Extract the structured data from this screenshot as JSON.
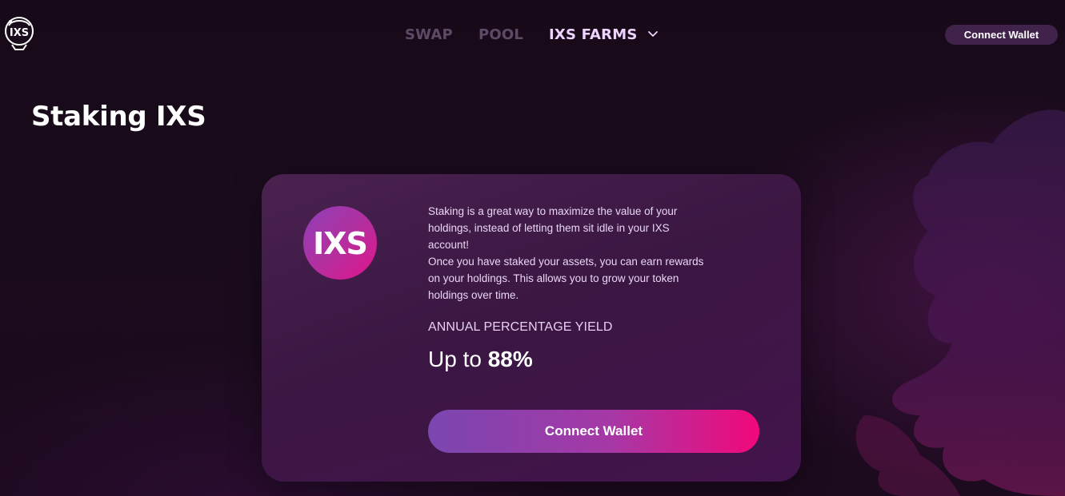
{
  "brand": {
    "logo_text": "IXS"
  },
  "nav": {
    "items": [
      {
        "label": "SWAP",
        "active": false
      },
      {
        "label": "POOL",
        "active": false
      },
      {
        "label": "IXS FARMS",
        "active": true,
        "has_dropdown": true
      }
    ]
  },
  "header": {
    "connect_wallet_label": "Connect Wallet"
  },
  "page": {
    "title": "Staking IXS"
  },
  "card": {
    "token_logo_text": "IXS",
    "description_lines": [
      "Staking is a great way to maximize the value of your",
      "holdings, instead of letting them sit idle in your IXS",
      "account!",
      "Once you have staked your assets, you can earn rewards",
      "on your holdings. This allows you to grow your token",
      "holdings over time."
    ],
    "apy_label": "ANNUAL PERCENTAGE YIELD",
    "apy_prefix": "Up to ",
    "apy_value": "88%",
    "cta_label": "Connect Wallet"
  },
  "colors": {
    "accent_start": "#7a46b0",
    "accent_end": "#f2087a",
    "nav_inactive": "#5e4a66",
    "nav_active": "#eed3ff",
    "header_button_bg": "#40224a"
  },
  "icons": {
    "logo": "ixs-astronaut-logo-icon",
    "dropdown": "chevron-down-icon",
    "token": "ixs-token-icon"
  }
}
